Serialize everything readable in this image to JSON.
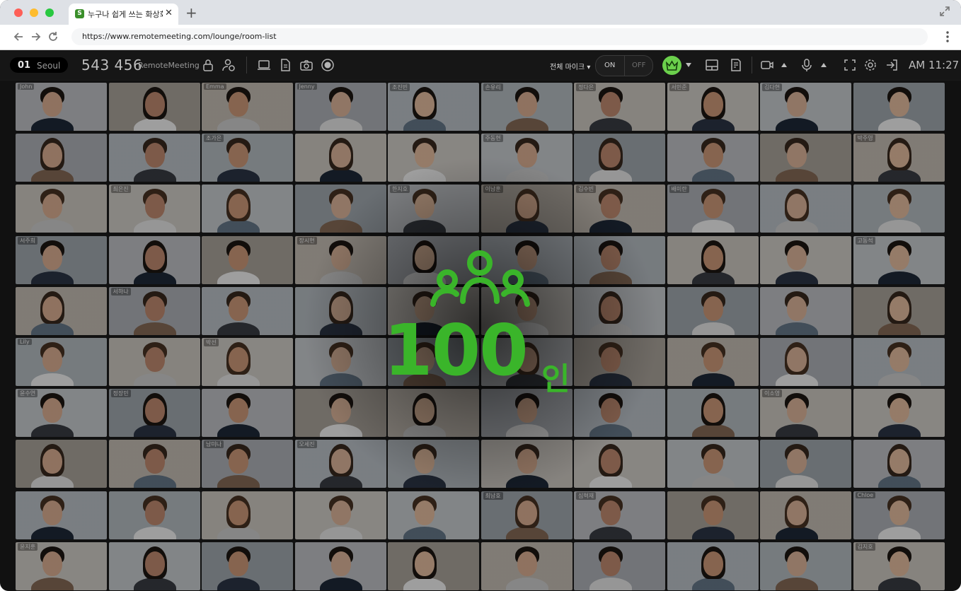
{
  "browser": {
    "tab_title": "누구나 쉽게 쓰는 화상회의",
    "favicon_letter": "S",
    "close_glyph": "✕",
    "new_tab_glyph": "+",
    "url": "https://www.remotemeeting.com/lounge/room-list"
  },
  "toolbar": {
    "room_number": "01",
    "room_city": "Seoul",
    "meeting_id": "543 456",
    "brand": "RemoteMeeting",
    "mic_all_label": "전체 마이크 ▾",
    "on_label": "ON",
    "off_label": "OFF",
    "time": "AM 11:27"
  },
  "overlay": {
    "count": "100",
    "unit": "인"
  },
  "participants": [
    "John",
    "",
    "Emma",
    "Jenny",
    "조진빈",
    "손유리",
    "정다은",
    "서민준",
    "김다현",
    "",
    "",
    "",
    "조가은",
    "",
    "",
    "주동현",
    "",
    "",
    "",
    "박주영",
    "",
    "최은진",
    "",
    "",
    "한지호",
    "이남훈",
    "김수빈",
    "배미란",
    "",
    "",
    "서주희",
    "",
    "",
    "장시현",
    "",
    "",
    "",
    "",
    "",
    "고동석",
    "",
    "서하나",
    "",
    "",
    "",
    "",
    "",
    "",
    "",
    "",
    "Lily",
    "",
    "박선",
    "",
    "",
    "",
    "",
    "",
    "",
    "",
    "윤수연",
    "정장민",
    "",
    "",
    "",
    "",
    "",
    "",
    "이소영",
    "",
    "",
    "",
    "남미나",
    "오세진",
    "",
    "",
    "",
    "",
    "",
    "",
    "",
    "",
    "",
    "",
    "",
    "최남호",
    "심혁재",
    "",
    "",
    "Chloe",
    "윤지훈",
    "",
    "",
    "",
    "",
    "",
    "",
    "",
    "",
    "김지호"
  ],
  "palette": {
    "brand_green": "#3ab52a",
    "crown_green": "#6bd04c"
  }
}
